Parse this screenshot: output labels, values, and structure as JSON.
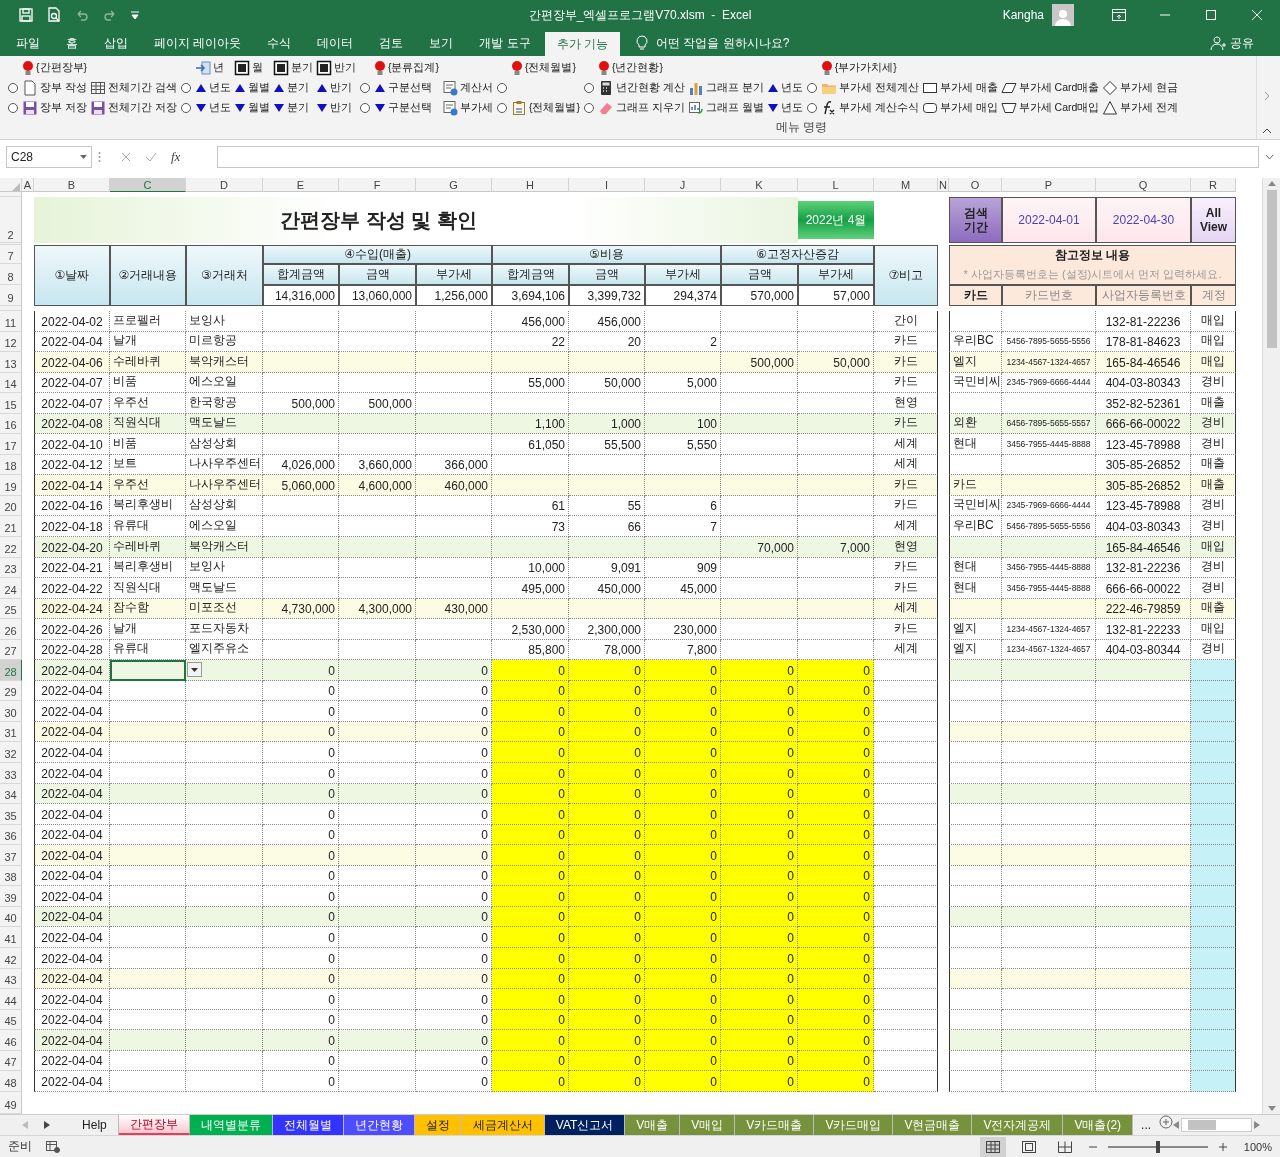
{
  "window": {
    "file_title": "간편장부_엑셀프로그램V70.xlsm  -  Excel",
    "user": "Kangha"
  },
  "menu_tabs": [
    {
      "label": "파일",
      "selected": false
    },
    {
      "label": "홈",
      "selected": false
    },
    {
      "label": "삽입",
      "selected": false
    },
    {
      "label": "페이지 레이아웃",
      "selected": false
    },
    {
      "label": "수식",
      "selected": false
    },
    {
      "label": "데이터",
      "selected": false
    },
    {
      "label": "검토",
      "selected": false
    },
    {
      "label": "보기",
      "selected": false
    },
    {
      "label": "개발 도구",
      "selected": false
    },
    {
      "label": "추가 기능",
      "selected": true
    }
  ],
  "tell_me": "어떤 작업을 원하시나요?",
  "share": "공유",
  "ribbon": {
    "group_label": "메뉴 명령",
    "columns": [
      {
        "items": [
          {
            "kind": "blank"
          },
          {
            "kind": "radio",
            "selected": false
          },
          {
            "kind": "radio",
            "selected": false
          }
        ]
      },
      {
        "items": [
          {
            "kind": "bulb",
            "label": "{간편장부}"
          },
          {
            "kind": "command",
            "label": "장부 작성"
          },
          {
            "kind": "command",
            "label": "장부 저장"
          }
        ]
      },
      {
        "items": [
          {
            "kind": "blank"
          },
          {
            "kind": "command",
            "label": "전체기간 검색"
          },
          {
            "kind": "command",
            "label": "전체기간 저장"
          }
        ]
      },
      {
        "items": [
          {
            "kind": "blank"
          },
          {
            "kind": "radio",
            "selected": false
          },
          {
            "kind": "radio",
            "selected": false
          }
        ]
      },
      {
        "items": [
          {
            "kind": "command",
            "label": "년"
          },
          {
            "kind": "up",
            "label": "년도"
          },
          {
            "kind": "down",
            "label": "년도"
          }
        ]
      },
      {
        "items": [
          {
            "kind": "command",
            "label": "월"
          },
          {
            "kind": "up",
            "label": "월별"
          },
          {
            "kind": "down",
            "label": "월별"
          }
        ]
      },
      {
        "items": [
          {
            "kind": "command",
            "label": "분기"
          },
          {
            "kind": "up",
            "label": "분기"
          },
          {
            "kind": "down",
            "label": "분기"
          }
        ]
      },
      {
        "items": [
          {
            "kind": "command",
            "label": "반기"
          },
          {
            "kind": "up",
            "label": "반기"
          },
          {
            "kind": "down",
            "label": "반기"
          }
        ]
      },
      {
        "items": [
          {
            "kind": "blank"
          },
          {
            "kind": "radio",
            "selected": false
          },
          {
            "kind": "radio",
            "selected": false
          }
        ]
      },
      {
        "items": [
          {
            "kind": "bulb",
            "label": "{분류집계}"
          },
          {
            "kind": "up",
            "label": "구분선택"
          },
          {
            "kind": "down",
            "label": "구분선택"
          }
        ]
      },
      {
        "items": [
          {
            "kind": "blank"
          },
          {
            "kind": "command",
            "label": "계산서"
          },
          {
            "kind": "command",
            "label": "부가세"
          }
        ]
      },
      {
        "items": [
          {
            "kind": "blank"
          },
          {
            "kind": "radio",
            "selected": false
          },
          {
            "kind": "radio",
            "selected": false
          }
        ]
      },
      {
        "items": [
          {
            "kind": "bulb",
            "label": "{전체월별}"
          },
          {
            "kind": "blank"
          },
          {
            "kind": "command",
            "label": "{전체월별}"
          }
        ]
      },
      {
        "items": [
          {
            "kind": "blank"
          },
          {
            "kind": "radio",
            "selected": false
          },
          {
            "kind": "radio",
            "selected": false
          }
        ]
      },
      {
        "items": [
          {
            "kind": "bulb",
            "label": "{년간현황}"
          },
          {
            "kind": "command",
            "label": "년간현황 계산"
          },
          {
            "kind": "command",
            "label": "그래프 지우기"
          }
        ]
      },
      {
        "items": [
          {
            "kind": "blank"
          },
          {
            "kind": "command",
            "label": "그래프 분기"
          },
          {
            "kind": "command",
            "label": "그래프 월별"
          }
        ]
      },
      {
        "items": [
          {
            "kind": "blank"
          },
          {
            "kind": "up",
            "label": "년도"
          },
          {
            "kind": "down",
            "label": "년도"
          }
        ]
      },
      {
        "items": [
          {
            "kind": "blank"
          },
          {
            "kind": "radio",
            "selected": false
          },
          {
            "kind": "radio",
            "selected": false
          }
        ]
      },
      {
        "items": [
          {
            "kind": "bulb",
            "label": "{부가가치세}"
          },
          {
            "kind": "command",
            "label": "부가세 전체계산"
          },
          {
            "kind": "command",
            "label": "부가세 계산수식"
          }
        ]
      },
      {
        "items": [
          {
            "kind": "blank"
          },
          {
            "kind": "command",
            "label": "부가세 매출"
          },
          {
            "kind": "command",
            "label": "부가세 매입"
          }
        ]
      },
      {
        "items": [
          {
            "kind": "blank"
          },
          {
            "kind": "command",
            "label": "부가세 Card매출"
          },
          {
            "kind": "command",
            "label": "부가세 Card매입"
          }
        ]
      },
      {
        "items": [
          {
            "kind": "blank"
          },
          {
            "kind": "command",
            "label": "부가세 현금"
          },
          {
            "kind": "command",
            "label": "부가세 전계"
          }
        ]
      }
    ]
  },
  "formula_bar": {
    "name_box": "C28",
    "fx": "fx"
  },
  "columns": [
    {
      "label": "A",
      "selected": false
    },
    {
      "label": "B",
      "selected": false
    },
    {
      "label": "C",
      "selected": true
    },
    {
      "label": "D",
      "selected": false
    },
    {
      "label": "E",
      "selected": false
    },
    {
      "label": "F",
      "selected": false
    },
    {
      "label": "G",
      "selected": false
    },
    {
      "label": "H",
      "selected": false
    },
    {
      "label": "I",
      "selected": false
    },
    {
      "label": "J",
      "selected": false
    },
    {
      "label": "K",
      "selected": false
    },
    {
      "label": "L",
      "selected": false
    },
    {
      "label": "M",
      "selected": false
    },
    {
      "label": "N",
      "selected": false
    },
    {
      "label": "O",
      "selected": false
    },
    {
      "label": "P",
      "selected": false
    },
    {
      "label": "Q",
      "selected": false
    },
    {
      "label": "R",
      "selected": false
    }
  ],
  "sheet_header": {
    "row_numbers": [
      "2",
      "7",
      "8",
      "9"
    ],
    "title": "간편장부 작성 및 확인",
    "period": "2022년 4월",
    "search_label": "검색 기간",
    "date_from": "2022-04-01",
    "date_to": "2022-04-30",
    "all_view": "All View",
    "fixed": [
      "①날짜",
      "②거래내용",
      "③거래처"
    ],
    "note_label": "⑦비고",
    "groups": [
      {
        "label": "④수입(매출)",
        "subs": [
          {
            "label": "합계금액",
            "total": "14,316,000"
          },
          {
            "label": "금액",
            "total": "13,060,000"
          },
          {
            "label": "부가세",
            "total": "1,256,000"
          }
        ]
      },
      {
        "label": "⑤비용",
        "subs": [
          {
            "label": "합계금액",
            "total": "3,694,106"
          },
          {
            "label": "금액",
            "total": "3,399,732"
          },
          {
            "label": "부가세",
            "total": "294,374"
          }
        ]
      },
      {
        "label": "⑥고정자산증감",
        "subs": [
          {
            "label": "금액",
            "total": "570,000"
          },
          {
            "label": "부가세",
            "total": "57,000"
          }
        ]
      }
    ],
    "reference": {
      "title": "참고정보 내용",
      "hint": "* 사업자등록번호는 (설정)시트에서 먼저 입력하세요.",
      "columns": [
        "카드",
        "카드번호",
        "사업자등록번호",
        "계정"
      ]
    }
  },
  "rows": [
    {
      "row": "11",
      "kind": "entry",
      "selected": false,
      "B": "2022-04-02",
      "C": "프로펠러",
      "D": "보잉사",
      "H": "456,000",
      "I": "456,000",
      "M": "간이",
      "Q": "132-81-22236",
      "R": "매입"
    },
    {
      "row": "12",
      "kind": "entry",
      "selected": false,
      "B": "2022-04-04",
      "C": "날개",
      "D": "미르항공",
      "H": "22",
      "I": "20",
      "J": "2",
      "M": "카드",
      "O": "우리BC",
      "P": "5456-7895-5655-5556",
      "Q": "178-81-84623",
      "R": "매입"
    },
    {
      "row": "13",
      "kind": "entry",
      "selected": false,
      "color": "#fcfce4",
      "B": "2022-04-06",
      "C": "수레바퀴",
      "D": "북악캐스터",
      "K": "500,000",
      "L": "50,000",
      "M": "카드",
      "O": "엘지",
      "P": "1234-4567-1324-4657",
      "Q": "165-84-46546",
      "R": "매입"
    },
    {
      "row": "14",
      "kind": "entry",
      "selected": false,
      "B": "2022-04-07",
      "C": "비품",
      "D": "에스오일",
      "H": "55,000",
      "I": "50,000",
      "J": "5,000",
      "M": "카드",
      "O": "국민비씨",
      "P": "2345-7969-6666-4444",
      "Q": "404-03-80343",
      "R": "경비"
    },
    {
      "row": "15",
      "kind": "entry",
      "selected": false,
      "B": "2022-04-07",
      "C": "우주선",
      "D": "한국항공",
      "E": "500,000",
      "F": "500,000",
      "M": "현영",
      "Q": "352-82-52361",
      "R": "매출"
    },
    {
      "row": "16",
      "kind": "entry",
      "selected": false,
      "color": "#eef7e2",
      "B": "2022-04-08",
      "C": "직원식대",
      "D": "맥도날드",
      "H": "1,100",
      "I": "1,000",
      "J": "100",
      "M": "카드",
      "O": "외환",
      "P": "6456-7895-5655-5557",
      "Q": "666-66-00022",
      "R": "경비"
    },
    {
      "row": "17",
      "kind": "entry",
      "selected": false,
      "B": "2022-04-10",
      "C": "비품",
      "D": "삼성상회",
      "H": "61,050",
      "I": "55,500",
      "J": "5,550",
      "M": "세계",
      "O": "현대",
      "P": "3456-7955-4445-8888",
      "Q": "123-45-78988",
      "R": "경비"
    },
    {
      "row": "18",
      "kind": "entry",
      "selected": false,
      "B": "2022-04-12",
      "C": "보트",
      "D": "나사우주센터",
      "E": "4,026,000",
      "F": "3,660,000",
      "G": "366,000",
      "M": "세계",
      "Q": "305-85-26852",
      "R": "매출"
    },
    {
      "row": "19",
      "kind": "entry",
      "selected": false,
      "color": "#fcfce4",
      "B": "2022-04-14",
      "C": "우주선",
      "D": "나사우주센터",
      "E": "5,060,000",
      "F": "4,600,000",
      "G": "460,000",
      "M": "카드",
      "O": "카드",
      "Q": "305-85-26852",
      "R": "매출"
    },
    {
      "row": "20",
      "kind": "entry",
      "selected": false,
      "B": "2022-04-16",
      "C": "복리후생비",
      "D": "삼성상회",
      "H": "61",
      "I": "55",
      "J": "6",
      "M": "카드",
      "O": "국민비씨",
      "P": "2345-7969-6666-4444",
      "Q": "123-45-78988",
      "R": "경비"
    },
    {
      "row": "21",
      "kind": "entry",
      "selected": false,
      "B": "2022-04-18",
      "C": "유류대",
      "D": "에스오일",
      "H": "73",
      "I": "66",
      "J": "7",
      "M": "세계",
      "O": "우리BC",
      "P": "5456-7895-5655-5556",
      "Q": "404-03-80343",
      "R": "경비"
    },
    {
      "row": "22",
      "kind": "entry",
      "selected": false,
      "color": "#eef7e2",
      "B": "2022-04-20",
      "C": "수레바퀴",
      "D": "북악캐스터",
      "K": "70,000",
      "L": "7,000",
      "M": "현영",
      "Q": "165-84-46546",
      "R": "매입"
    },
    {
      "row": "23",
      "kind": "entry",
      "selected": false,
      "B": "2022-04-21",
      "C": "복리후생비",
      "D": "보잉사",
      "H": "10,000",
      "I": "9,091",
      "J": "909",
      "M": "카드",
      "O": "현대",
      "P": "3456-7955-4445-8888",
      "Q": "132-81-22236",
      "R": "경비"
    },
    {
      "row": "24",
      "kind": "entry",
      "selected": false,
      "B": "2022-04-22",
      "C": "직원식대",
      "D": "맥도날드",
      "H": "495,000",
      "I": "450,000",
      "J": "45,000",
      "M": "카드",
      "O": "현대",
      "P": "3456-7955-4445-8888",
      "Q": "666-66-00022",
      "R": "경비"
    },
    {
      "row": "25",
      "kind": "entry",
      "selected": false,
      "color": "#fcfce4",
      "B": "2022-04-24",
      "C": "잠수함",
      "D": "미포조선",
      "E": "4,730,000",
      "F": "4,300,000",
      "G": "430,000",
      "M": "세계",
      "Q": "222-46-79859",
      "R": "매출"
    },
    {
      "row": "26",
      "kind": "entry",
      "selected": false,
      "B": "2022-04-26",
      "C": "날개",
      "D": "포드자동차",
      "H": "2,530,000",
      "I": "2,300,000",
      "J": "230,000",
      "M": "카드",
      "O": "엘지",
      "P": "1234-4567-1324-4657",
      "Q": "132-81-22233",
      "R": "매입"
    },
    {
      "row": "27",
      "kind": "entry",
      "selected": false,
      "B": "2022-04-28",
      "C": "유류대",
      "D": "엘지주유소",
      "H": "85,800",
      "I": "78,000",
      "J": "7,800",
      "M": "세계",
      "O": "엘지",
      "P": "1234-4567-1324-4657",
      "Q": "404-03-80344",
      "R": "경비"
    },
    {
      "row": "28",
      "kind": "template",
      "selected": true,
      "color": "#eef7e2",
      "B": "2022-04-04",
      "E": "0",
      "G": "0",
      "H": "0",
      "I": "0",
      "J": "0",
      "K": "0",
      "L": "0"
    },
    {
      "row": "29",
      "kind": "template",
      "selected": false,
      "B": "2022-04-04",
      "E": "0",
      "G": "0",
      "H": "0",
      "I": "0",
      "J": "0",
      "K": "0",
      "L": "0"
    },
    {
      "row": "30",
      "kind": "template",
      "selected": false,
      "B": "2022-04-04",
      "E": "0",
      "G": "0",
      "H": "0",
      "I": "0",
      "J": "0",
      "K": "0",
      "L": "0"
    },
    {
      "row": "31",
      "kind": "template",
      "selected": false,
      "color": "#fcfce4",
      "B": "2022-04-04",
      "E": "0",
      "G": "0",
      "H": "0",
      "I": "0",
      "J": "0",
      "K": "0",
      "L": "0"
    },
    {
      "row": "32",
      "kind": "template",
      "selected": false,
      "B": "2022-04-04",
      "E": "0",
      "G": "0",
      "H": "0",
      "I": "0",
      "J": "0",
      "K": "0",
      "L": "0"
    },
    {
      "row": "33",
      "kind": "template",
      "selected": false,
      "B": "2022-04-04",
      "E": "0",
      "G": "0",
      "H": "0",
      "I": "0",
      "J": "0",
      "K": "0",
      "L": "0"
    },
    {
      "row": "34",
      "kind": "template",
      "selected": false,
      "color": "#eef7e2",
      "B": "2022-04-04",
      "E": "0",
      "G": "0",
      "H": "0",
      "I": "0",
      "J": "0",
      "K": "0",
      "L": "0"
    },
    {
      "row": "35",
      "kind": "template",
      "selected": false,
      "B": "2022-04-04",
      "E": "0",
      "G": "0",
      "H": "0",
      "I": "0",
      "J": "0",
      "K": "0",
      "L": "0"
    },
    {
      "row": "36",
      "kind": "template",
      "selected": false,
      "B": "2022-04-04",
      "E": "0",
      "G": "0",
      "H": "0",
      "I": "0",
      "J": "0",
      "K": "0",
      "L": "0"
    },
    {
      "row": "37",
      "kind": "template",
      "selected": false,
      "color": "#fcfce4",
      "B": "2022-04-04",
      "E": "0",
      "G": "0",
      "H": "0",
      "I": "0",
      "J": "0",
      "K": "0",
      "L": "0"
    },
    {
      "row": "38",
      "kind": "template",
      "selected": false,
      "B": "2022-04-04",
      "E": "0",
      "G": "0",
      "H": "0",
      "I": "0",
      "J": "0",
      "K": "0",
      "L": "0"
    },
    {
      "row": "39",
      "kind": "template",
      "selected": false,
      "B": "2022-04-04",
      "E": "0",
      "G": "0",
      "H": "0",
      "I": "0",
      "J": "0",
      "K": "0",
      "L": "0"
    },
    {
      "row": "40",
      "kind": "template",
      "selected": false,
      "color": "#eef7e2",
      "B": "2022-04-04",
      "E": "0",
      "G": "0",
      "H": "0",
      "I": "0",
      "J": "0",
      "K": "0",
      "L": "0"
    },
    {
      "row": "41",
      "kind": "template",
      "selected": false,
      "B": "2022-04-04",
      "E": "0",
      "G": "0",
      "H": "0",
      "I": "0",
      "J": "0",
      "K": "0",
      "L": "0"
    },
    {
      "row": "42",
      "kind": "template",
      "selected": false,
      "B": "2022-04-04",
      "E": "0",
      "G": "0",
      "H": "0",
      "I": "0",
      "J": "0",
      "K": "0",
      "L": "0"
    },
    {
      "row": "43",
      "kind": "template",
      "selected": false,
      "color": "#fcfce4",
      "B": "2022-04-04",
      "E": "0",
      "G": "0",
      "H": "0",
      "I": "0",
      "J": "0",
      "K": "0",
      "L": "0"
    },
    {
      "row": "44",
      "kind": "template",
      "selected": false,
      "B": "2022-04-04",
      "E": "0",
      "G": "0",
      "H": "0",
      "I": "0",
      "J": "0",
      "K": "0",
      "L": "0"
    },
    {
      "row": "45",
      "kind": "template",
      "selected": false,
      "B": "2022-04-04",
      "E": "0",
      "G": "0",
      "H": "0",
      "I": "0",
      "J": "0",
      "K": "0",
      "L": "0"
    },
    {
      "row": "46",
      "kind": "template",
      "selected": false,
      "color": "#eef7e2",
      "B": "2022-04-04",
      "E": "0",
      "G": "0",
      "H": "0",
      "I": "0",
      "J": "0",
      "K": "0",
      "L": "0"
    },
    {
      "row": "47",
      "kind": "template",
      "selected": false,
      "B": "2022-04-04",
      "E": "0",
      "G": "0",
      "H": "0",
      "I": "0",
      "J": "0",
      "K": "0",
      "L": "0"
    },
    {
      "row": "48",
      "kind": "template",
      "selected": false,
      "B": "2022-04-04",
      "E": "0",
      "G": "0",
      "H": "0",
      "I": "0",
      "J": "0",
      "K": "0",
      "L": "0"
    }
  ],
  "last_row": "49",
  "sheet_tabs": [
    {
      "label": "Help",
      "selected": false,
      "color": "#f0f0f0"
    },
    {
      "label": "간편장부",
      "selected": true,
      "color": "#f8c8d0"
    },
    {
      "label": "내역별분류",
      "selected": false,
      "color": "#00b050"
    },
    {
      "label": "전체월별",
      "selected": false,
      "color": "#3333ff"
    },
    {
      "label": "년간현황",
      "selected": false,
      "color": "#4d4dff"
    },
    {
      "label": "설정",
      "selected": false,
      "color": "#ffc000"
    },
    {
      "label": "세금계산서",
      "selected": false,
      "color": "#ffc000"
    },
    {
      "label": "VAT신고서",
      "selected": false,
      "color": "#002060"
    },
    {
      "label": "V매출",
      "selected": false,
      "color": "#76923c"
    },
    {
      "label": "V매입",
      "selected": false,
      "color": "#76923c"
    },
    {
      "label": "V카드매출",
      "selected": false,
      "color": "#76923c"
    },
    {
      "label": "V카드매입",
      "selected": false,
      "color": "#76923c"
    },
    {
      "label": "V현금매출",
      "selected": false,
      "color": "#76923c"
    },
    {
      "label": "V전자계공제",
      "selected": false,
      "color": "#76923c"
    },
    {
      "label": "V매출(2)",
      "selected": false,
      "color": "#76923c"
    }
  ],
  "more_tabs": "...",
  "status_bar": {
    "status": "준비",
    "zoom": "100%",
    "zoom_slider": {
      "level": 0.5
    }
  }
}
